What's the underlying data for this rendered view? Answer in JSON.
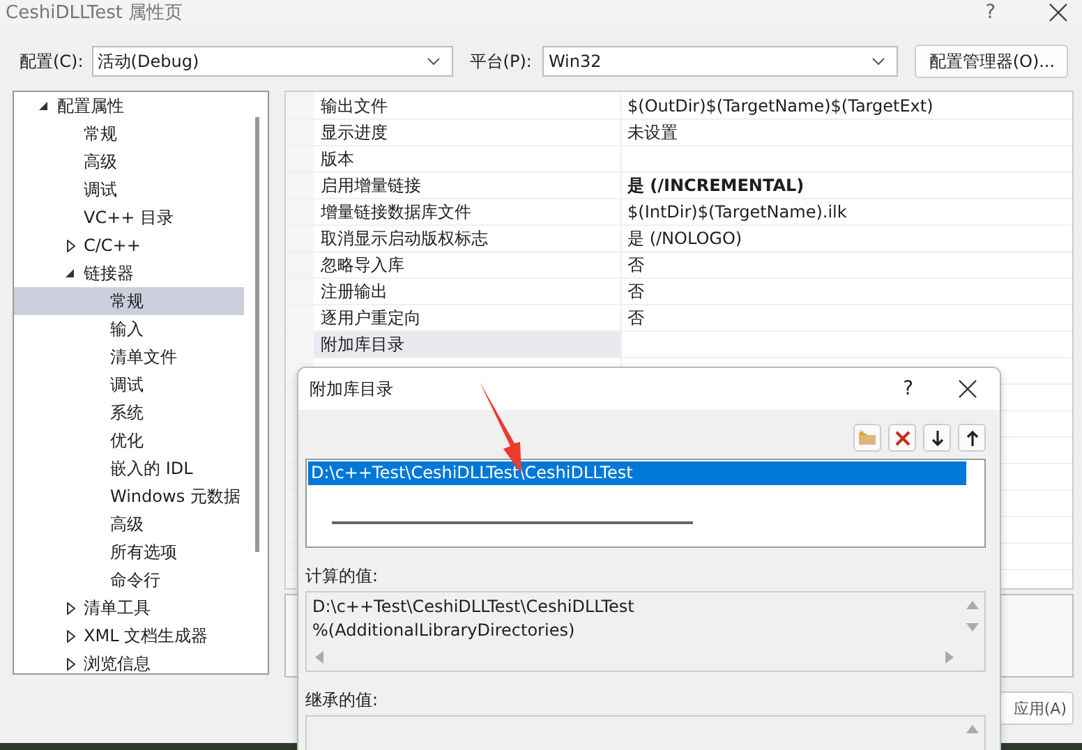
{
  "window": {
    "title": "CeshiDLLTest 属性页",
    "help": "?"
  },
  "config_bar": {
    "configuration_label": "配置(C):",
    "configuration_value": "活动(Debug)",
    "platform_label": "平台(P):",
    "platform_value": "Win32",
    "manager_button": "配置管理器(O)..."
  },
  "tree": [
    {
      "label": "配置属性",
      "expanded": true,
      "selected": false,
      "children": [
        {
          "label": "常规",
          "selected": false
        },
        {
          "label": "高级",
          "selected": false
        },
        {
          "label": "调试",
          "selected": false
        },
        {
          "label": "VC++ 目录",
          "selected": false
        },
        {
          "label": "C/C++",
          "expanded": false,
          "selected": false
        },
        {
          "label": "链接器",
          "expanded": true,
          "selected": false,
          "children": [
            {
              "label": "常规",
              "selected": true
            },
            {
              "label": "输入",
              "selected": false
            },
            {
              "label": "清单文件",
              "selected": false
            },
            {
              "label": "调试",
              "selected": false
            },
            {
              "label": "系统",
              "selected": false
            },
            {
              "label": "优化",
              "selected": false
            },
            {
              "label": "嵌入的 IDL",
              "selected": false
            },
            {
              "label": "Windows 元数据",
              "selected": false
            },
            {
              "label": "高级",
              "selected": false
            },
            {
              "label": "所有选项",
              "selected": false
            },
            {
              "label": "命令行",
              "selected": false
            }
          ]
        },
        {
          "label": "清单工具",
          "expanded": false,
          "selected": false
        },
        {
          "label": "XML 文档生成器",
          "expanded": false,
          "selected": false
        },
        {
          "label": "浏览信息",
          "expanded": false,
          "selected": false
        }
      ]
    }
  ],
  "properties": [
    {
      "name": "输出文件",
      "value": "$(OutDir)$(TargetName)$(TargetExt)",
      "bold": false,
      "selected": false
    },
    {
      "name": "显示进度",
      "value": "未设置",
      "bold": false,
      "selected": false
    },
    {
      "name": "版本",
      "selected": false
    },
    {
      "name": "启用增量链接",
      "value": "是 (/INCREMENTAL)",
      "bold": true,
      "selected": false
    },
    {
      "name": "增量链接数据库文件",
      "value": "$(IntDir)$(TargetName).ilk",
      "bold": false,
      "selected": false
    },
    {
      "name": "取消显示启动版权标志",
      "value": "是 (/NOLOGO)",
      "bold": false,
      "selected": false
    },
    {
      "name": "忽略导入库",
      "value": "否",
      "bold": false,
      "selected": false
    },
    {
      "name": "注册输出",
      "value": "否",
      "bold": false,
      "selected": false
    },
    {
      "name": "逐用户重定向",
      "value": "否",
      "bold": false,
      "selected": false
    },
    {
      "name": "附加库目录",
      "selected": true
    }
  ],
  "footer": {
    "apply_button": "应用(A)"
  },
  "dialog": {
    "title": "附加库目录",
    "help": "?",
    "entries": [
      {
        "text": "D:\\c++Test\\CeshiDLLTest\\CeshiDLLTest",
        "selected": true
      }
    ],
    "computed_label": "计算的值:",
    "computed_lines": [
      "D:\\c++Test\\CeshiDLLTest\\CeshiDLLTest",
      "%(AdditionalLibraryDirectories)"
    ],
    "inherited_label": "继承的值:"
  }
}
